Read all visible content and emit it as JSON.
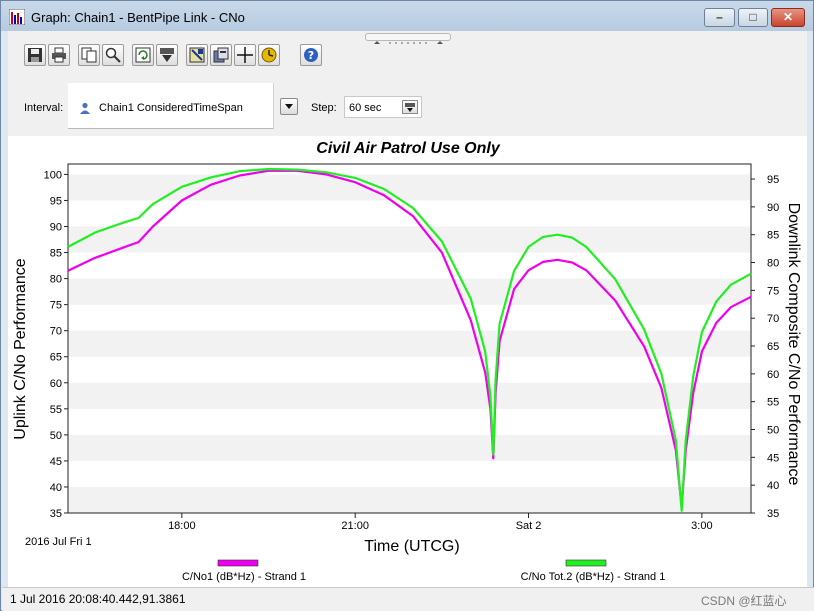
{
  "window": {
    "title": "Graph:  Chain1 - BentPipe Link - CNo",
    "min_label": "–",
    "max_label": "□",
    "close_label": "✕"
  },
  "toolbar": {
    "buttons": [
      "save-icon",
      "print-icon",
      "copy-icon",
      "zoom-icon",
      "refresh-icon",
      "export-icon",
      "options-icon",
      "properties-icon",
      "crosshair-icon",
      "animation-icon",
      "help-icon"
    ]
  },
  "controls": {
    "interval_label": "Interval:",
    "interval_value": "Chain1 ConsideredTimeSpan",
    "step_label": "Step:",
    "step_value": "60 sec"
  },
  "status": {
    "coordinates": "1 Jul 2016 20:08:40.442,91.3861",
    "watermark": "CSDN @红蓝心"
  },
  "colors": {
    "series1": "#ee00ee",
    "series2": "#22ee22",
    "band": "#f2f2f2"
  },
  "chart_data": {
    "type": "line",
    "title": "Civil Air Patrol Use Only",
    "xlabel": "Time (UTCG)",
    "ylabel_left": "Uplink C/No Performance",
    "ylabel_right": "Downlink Composite C/No Performance",
    "date_label": "2016 Jul Fri 1",
    "x_ticks": [
      {
        "t": 18.0,
        "label": "18:00"
      },
      {
        "t": 21.0,
        "label": "21:00"
      },
      {
        "t": 24.0,
        "label": "Sat 2"
      },
      {
        "t": 27.0,
        "label": "3:00"
      }
    ],
    "xlim": [
      16.03,
      27.85
    ],
    "ylim_left": [
      35,
      102
    ],
    "ylim_right": [
      35,
      97.7
    ],
    "left_ticks": [
      35,
      40,
      45,
      50,
      55,
      60,
      65,
      70,
      75,
      80,
      85,
      90,
      95,
      100
    ],
    "right_ticks": [
      35,
      40,
      45,
      50,
      55,
      60,
      65,
      70,
      75,
      80,
      85,
      90,
      95
    ],
    "series": [
      {
        "name": "C/No1 (dB*Hz) - Strand 1",
        "axis": "left",
        "points": [
          [
            16.03,
            81.5
          ],
          [
            16.5,
            84.0
          ],
          [
            17.0,
            86.0
          ],
          [
            17.25,
            87.0
          ],
          [
            17.5,
            90.0
          ],
          [
            18.0,
            95.0
          ],
          [
            18.5,
            98.0
          ],
          [
            19.0,
            99.8
          ],
          [
            19.5,
            100.7
          ],
          [
            20.0,
            100.7
          ],
          [
            20.5,
            100.0
          ],
          [
            21.0,
            98.5
          ],
          [
            21.5,
            96.0
          ],
          [
            22.0,
            92.0
          ],
          [
            22.5,
            85.0
          ],
          [
            23.0,
            72.0
          ],
          [
            23.25,
            62.0
          ],
          [
            23.34,
            55.0
          ],
          [
            23.39,
            45.5
          ],
          [
            23.43,
            58.0
          ],
          [
            23.5,
            68.0
          ],
          [
            23.75,
            78.0
          ],
          [
            24.0,
            81.6
          ],
          [
            24.25,
            83.2
          ],
          [
            24.5,
            83.6
          ],
          [
            24.75,
            83.1
          ],
          [
            25.0,
            81.6
          ],
          [
            25.5,
            75.8
          ],
          [
            26.0,
            67.0
          ],
          [
            26.3,
            59.0
          ],
          [
            26.55,
            47.0
          ],
          [
            26.65,
            36.0
          ],
          [
            26.72,
            47.0
          ],
          [
            26.85,
            58.0
          ],
          [
            27.0,
            66.0
          ],
          [
            27.25,
            71.5
          ],
          [
            27.5,
            74.5
          ],
          [
            27.85,
            76.5
          ]
        ]
      },
      {
        "name": "C/No Tot.2 (dB*Hz) - Strand 1",
        "axis": "right",
        "points": [
          [
            16.03,
            82.8
          ],
          [
            16.5,
            85.4
          ],
          [
            17.0,
            87.2
          ],
          [
            17.25,
            88.0
          ],
          [
            17.5,
            90.5
          ],
          [
            18.0,
            93.6
          ],
          [
            18.5,
            95.3
          ],
          [
            19.0,
            96.4
          ],
          [
            19.5,
            96.8
          ],
          [
            20.0,
            96.7
          ],
          [
            20.5,
            96.2
          ],
          [
            21.0,
            95.2
          ],
          [
            21.5,
            93.2
          ],
          [
            22.0,
            89.8
          ],
          [
            22.5,
            83.8
          ],
          [
            23.0,
            73.5
          ],
          [
            23.25,
            64.0
          ],
          [
            23.34,
            56.0
          ],
          [
            23.39,
            45.5
          ],
          [
            23.43,
            59.0
          ],
          [
            23.5,
            69.0
          ],
          [
            23.75,
            78.5
          ],
          [
            24.0,
            82.8
          ],
          [
            24.25,
            84.6
          ],
          [
            24.5,
            85.0
          ],
          [
            24.75,
            84.5
          ],
          [
            25.0,
            82.8
          ],
          [
            25.5,
            77.0
          ],
          [
            26.0,
            68.0
          ],
          [
            26.3,
            60.0
          ],
          [
            26.55,
            48.0
          ],
          [
            26.65,
            35.4
          ],
          [
            26.72,
            48.0
          ],
          [
            26.85,
            59.5
          ],
          [
            27.0,
            67.5
          ],
          [
            27.25,
            73.0
          ],
          [
            27.5,
            76.0
          ],
          [
            27.85,
            78.0
          ]
        ]
      }
    ]
  }
}
